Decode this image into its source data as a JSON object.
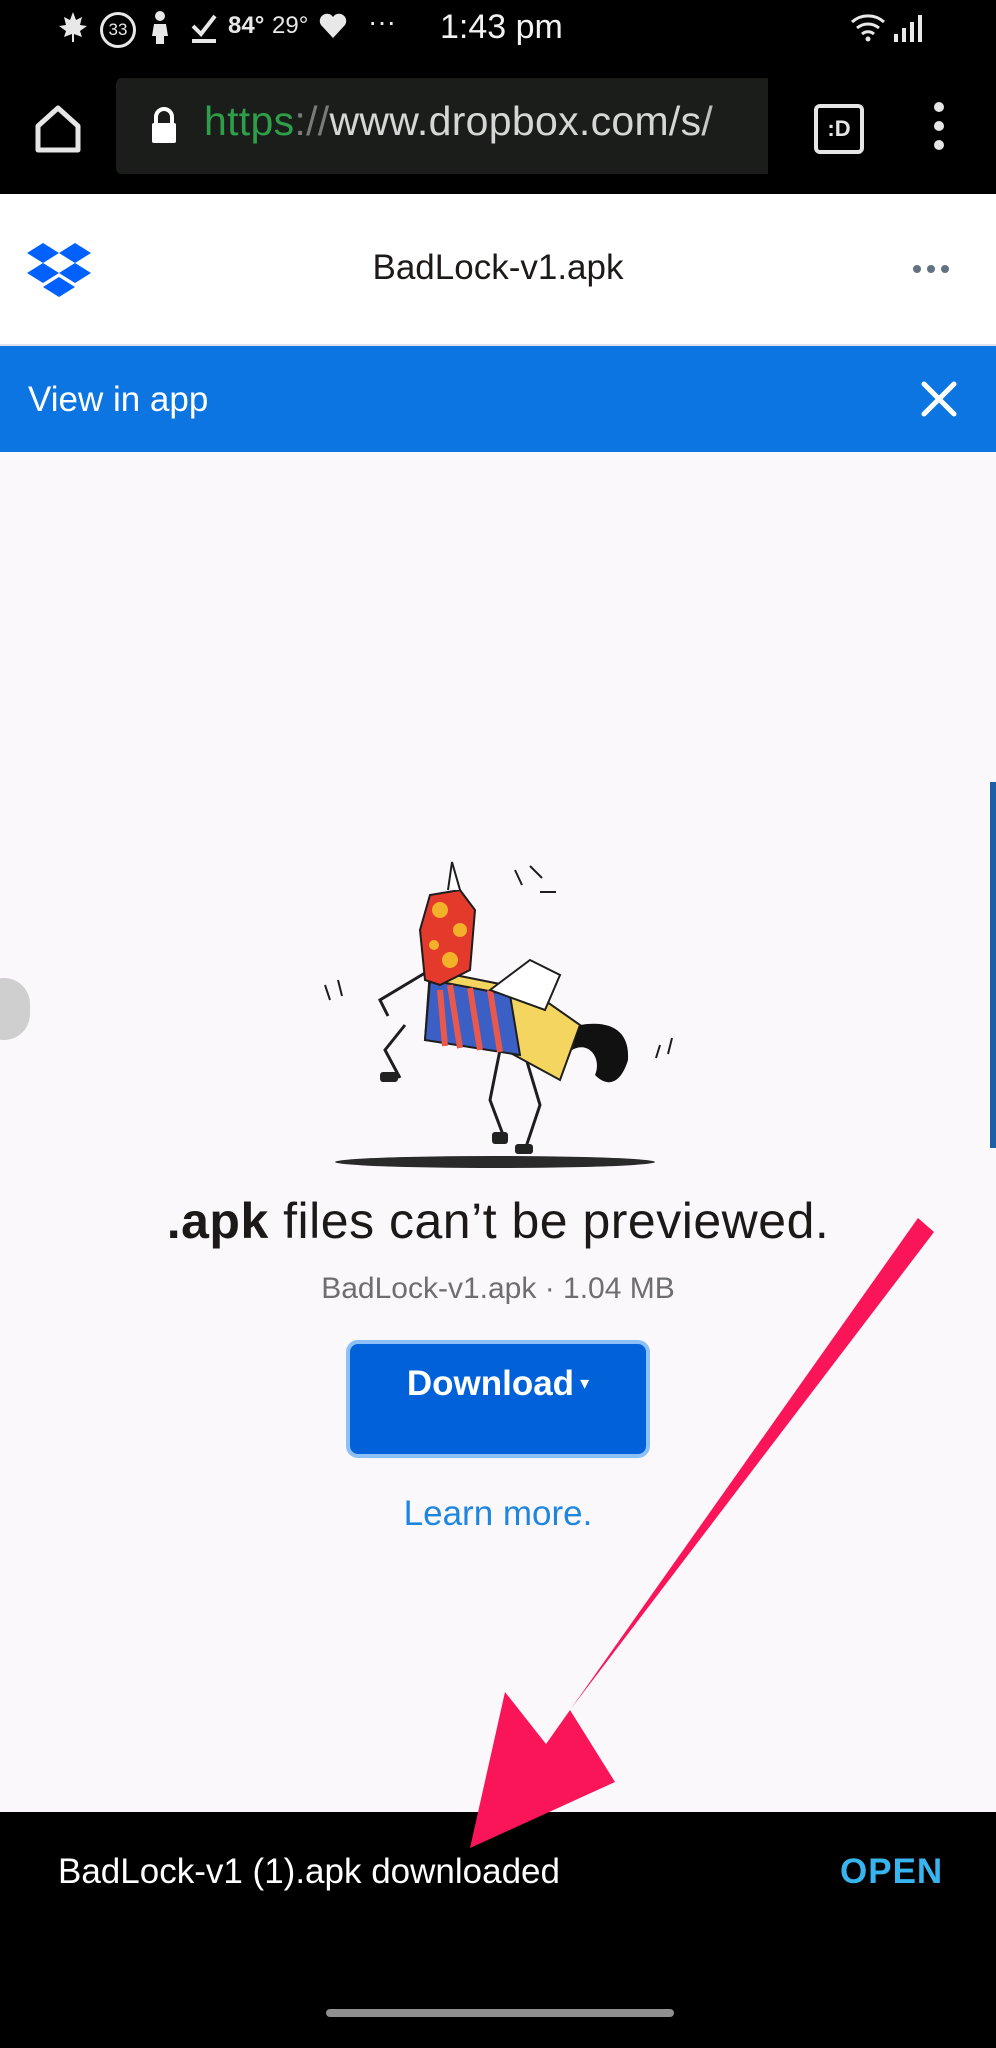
{
  "status_bar": {
    "temp1": "84°",
    "temp2": "29°",
    "badge_count": "33",
    "dots": "···",
    "time": "1:43 pm"
  },
  "browser": {
    "url_scheme": "https",
    "url_separator": "://",
    "url_rest": "www.dropbox.com/s/",
    "tabs_label": ":D"
  },
  "header": {
    "file_name": "BadLock-v1.apk"
  },
  "banner": {
    "text": "View in app"
  },
  "main": {
    "ext": ".apk",
    "message_rest": " files can’t be previewed.",
    "file_meta": "BadLock-v1.apk · 1.04 MB",
    "download_label": "Download",
    "download_caret": "▾",
    "learn_more": "Learn more."
  },
  "snackbar": {
    "message": "BadLock-v1 (1).apk downloaded",
    "action": "OPEN"
  },
  "colors": {
    "banner": "#0d75e2",
    "download_button": "#0061d9",
    "snackbar_action": "#37b5ee",
    "annotation_arrow": "#fa1558",
    "url_scheme": "#2e9e49"
  },
  "icons": [
    "maple-leaf-icon",
    "badge-icon",
    "person-icon",
    "check-icon",
    "heart-icon",
    "wifi-icon",
    "signal-icon",
    "home-icon",
    "lock-icon",
    "tabs-icon",
    "overflow-menu-icon",
    "dropbox-logo-icon",
    "more-horizontal-icon",
    "close-icon",
    "dropdown-caret-icon"
  ]
}
